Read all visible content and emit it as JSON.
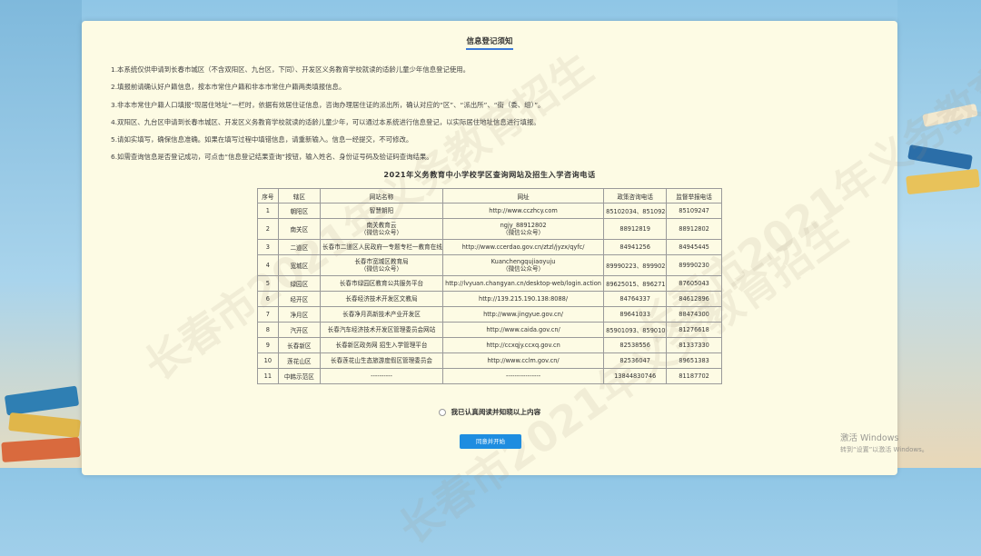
{
  "watermark": "长春市2021年义务教育招生",
  "notice": {
    "title": "信息登记须知",
    "items": [
      "1.本系统仅供申请到长春市城区（不含双阳区、九台区，下同）、开发区义务教育学校就读的适龄儿童少年信息登记使用。",
      "2.填报前请确认好户籍信息，按本市常住户籍和非本市常住户籍两类填报信息。",
      "3.非本市常住户籍人口填报“现居住地址”一栏时，依据有效居住证信息，咨询办理居住证的派出所，确认对应的“区”、“派出所”、“街（委、组）”。",
      "4.双阳区、九台区申请到长春市城区、开发区义务教育学校就读的适龄儿童少年，可以通过本系统进行信息登记，以实际居住地址信息进行填报。",
      "5.请如实填写，确保信息准确。如果在填写过程中填错信息，请重新输入。信息一经提交，不可修改。",
      "6.如需查询信息是否登记成功，可点击“信息登记结果查询”按钮，输入姓名、身份证号码及验证码查询结果。"
    ]
  },
  "table": {
    "title": "2021年义务教育中小学校学区查询网站及招生入学咨询电话",
    "headers": [
      "序号",
      "辖区",
      "网站名称",
      "网址",
      "政策咨询电话",
      "监督举报电话"
    ],
    "rows": [
      {
        "no": "1",
        "district": "朝阳区",
        "site": "智慧朝阳",
        "site2": "",
        "url": "http://www.cczhcy.com",
        "url2": "",
        "policy": "85102034、85109243",
        "report": "85109247"
      },
      {
        "no": "2",
        "district": "南关区",
        "site": "南关教育云",
        "site2": "（微信公众号）",
        "url": "ngjy_88912802",
        "url2": "（微信公众号）",
        "policy": "88912819",
        "report": "88912802"
      },
      {
        "no": "3",
        "district": "二道区",
        "site": "长春市二道区人民政府一专题专栏一教育在线",
        "site2": "",
        "url": "http://www.ccerdao.gov.cn/ztzl/jyzx/qyfc/",
        "url2": "",
        "policy": "84941256",
        "report": "84945445"
      },
      {
        "no": "4",
        "district": "宽城区",
        "site": "长春市宽城区教育局",
        "site2": "（微信公众号）",
        "url": "Kuanchengqujiaoyuju",
        "url2": "（微信公众号）",
        "policy": "89990223、89990224",
        "report": "89990230"
      },
      {
        "no": "5",
        "district": "绿园区",
        "site": "长春市绿园区教育公共服务平台",
        "site2": "",
        "url": "http://lvyuan.changyan.cn/desktop-web/login.action",
        "url2": "",
        "policy": "89625015、89627105",
        "report": "87605043"
      },
      {
        "no": "6",
        "district": "经开区",
        "site": "长春经济技术开发区文教局",
        "site2": "",
        "url": "http://139.215.190.138:8088/",
        "url2": "",
        "policy": "84764337",
        "report": "84612896"
      },
      {
        "no": "7",
        "district": "净月区",
        "site": "长春净月高新技术产业开发区",
        "site2": "",
        "url": "http://www.jingyue.gov.cn/",
        "url2": "",
        "policy": "89641033",
        "report": "88474300"
      },
      {
        "no": "8",
        "district": "汽开区",
        "site": "长春汽车经济技术开发区管理委员会网站",
        "site2": "",
        "url": "http://www.caida.gov.cn/",
        "url2": "",
        "policy": "85901093、85901094",
        "report": "81276618"
      },
      {
        "no": "9",
        "district": "长春新区",
        "site": "长春新区政务网 招生入学管理平台",
        "site2": "",
        "url": "http://ccxqjy.ccxq.gov.cn",
        "url2": "",
        "policy": "82538556",
        "report": "81337330"
      },
      {
        "no": "10",
        "district": "莲花山区",
        "site": "长春莲花山生态旅游度假区管理委员会",
        "site2": "",
        "url": "http://www.cclm.gov.cn/",
        "url2": "",
        "policy": "82536047",
        "report": "89651383"
      },
      {
        "no": "11",
        "district": "中韩示范区",
        "site": "----------",
        "site2": "",
        "url": "----------------",
        "url2": "",
        "policy": "13844830746",
        "report": "81187702"
      }
    ]
  },
  "agree_label": "我已认真阅读并知晓以上内容",
  "start_button": "同意并开始",
  "windows": {
    "line1": "激活 Windows",
    "line2": "转到“设置”以激活 Windows。"
  }
}
